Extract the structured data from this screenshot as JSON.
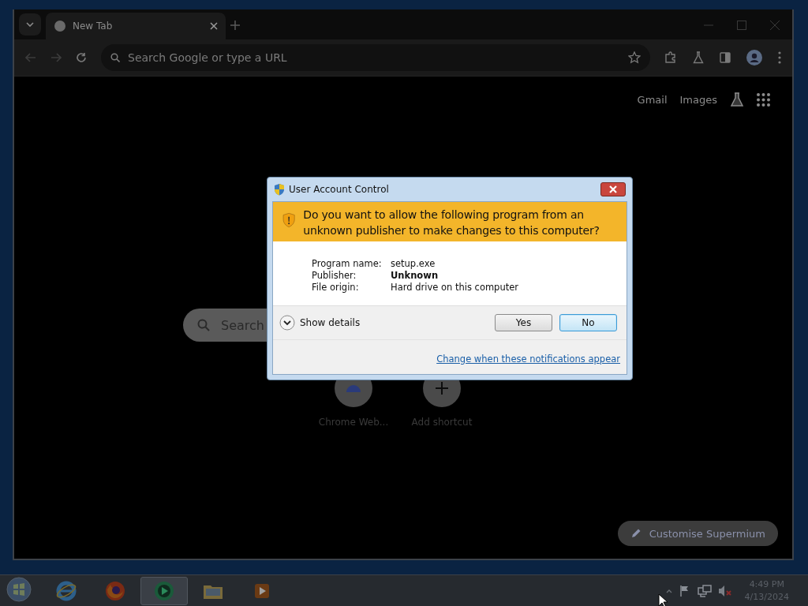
{
  "browser": {
    "tabs": [
      {
        "title": "New Tab",
        "selected": true
      }
    ],
    "omnibox": {
      "placeholder": "Search Google or type a URL"
    },
    "ntp_links": [
      "Gmail",
      "Images"
    ],
    "search_box": {
      "placeholder": "Search"
    },
    "shortcuts": [
      {
        "label": "Chrome Web...",
        "kind": "webstore"
      },
      {
        "label": "Add shortcut",
        "kind": "add"
      }
    ],
    "customise_button": "Customise Supermium"
  },
  "dialog": {
    "title": "User Account Control",
    "question": "Do you want to allow the following program from an unknown publisher to make changes to this computer?",
    "details": [
      {
        "label": "Program name:",
        "value": "setup.exe",
        "bold": false
      },
      {
        "label": "Publisher:",
        "value": "Unknown",
        "bold": true
      },
      {
        "label": "File origin:",
        "value": "Hard drive on this computer",
        "bold": false
      }
    ],
    "show_details": "Show details",
    "buttons": [
      {
        "label": "Yes",
        "selected": false
      },
      {
        "label": "No",
        "selected": true
      }
    ],
    "link": "Change when these notifications appear"
  },
  "taskbar": {
    "apps": [
      {
        "kind": "ie",
        "selected": false
      },
      {
        "kind": "firefox",
        "selected": false
      },
      {
        "kind": "green",
        "selected": true
      },
      {
        "kind": "folder",
        "selected": false
      },
      {
        "kind": "media",
        "selected": false
      }
    ],
    "clock": {
      "time": "4:49 PM",
      "date": "4/13/2024"
    }
  }
}
